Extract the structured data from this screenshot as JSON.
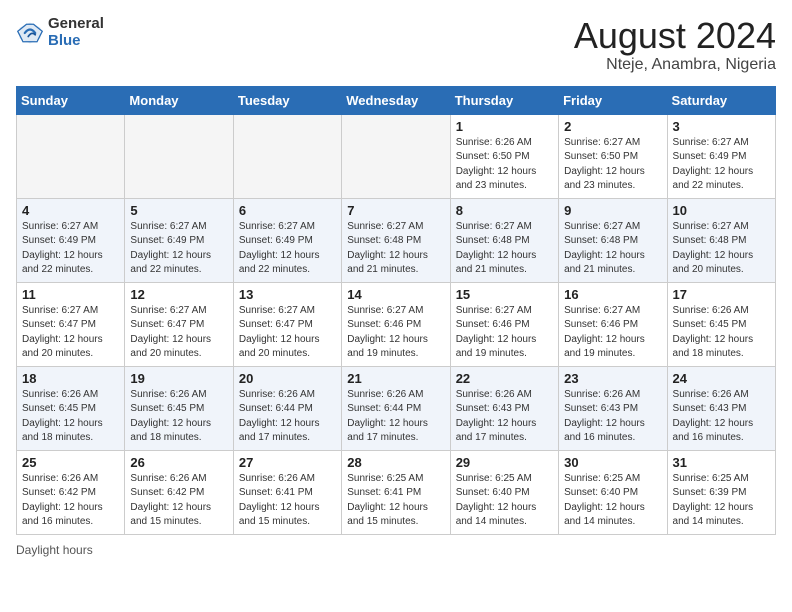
{
  "logo": {
    "general": "General",
    "blue": "Blue"
  },
  "header": {
    "title": "August 2024",
    "subtitle": "Nteje, Anambra, Nigeria"
  },
  "calendar": {
    "days_of_week": [
      "Sunday",
      "Monday",
      "Tuesday",
      "Wednesday",
      "Thursday",
      "Friday",
      "Saturday"
    ],
    "weeks": [
      {
        "cells": [
          {
            "day": "",
            "info": "",
            "empty": true
          },
          {
            "day": "",
            "info": "",
            "empty": true
          },
          {
            "day": "",
            "info": "",
            "empty": true
          },
          {
            "day": "",
            "info": "",
            "empty": true
          },
          {
            "day": "1",
            "info": "Sunrise: 6:26 AM\nSunset: 6:50 PM\nDaylight: 12 hours\nand 23 minutes.",
            "empty": false
          },
          {
            "day": "2",
            "info": "Sunrise: 6:27 AM\nSunset: 6:50 PM\nDaylight: 12 hours\nand 23 minutes.",
            "empty": false
          },
          {
            "day": "3",
            "info": "Sunrise: 6:27 AM\nSunset: 6:49 PM\nDaylight: 12 hours\nand 22 minutes.",
            "empty": false
          }
        ]
      },
      {
        "cells": [
          {
            "day": "4",
            "info": "Sunrise: 6:27 AM\nSunset: 6:49 PM\nDaylight: 12 hours\nand 22 minutes.",
            "empty": false
          },
          {
            "day": "5",
            "info": "Sunrise: 6:27 AM\nSunset: 6:49 PM\nDaylight: 12 hours\nand 22 minutes.",
            "empty": false
          },
          {
            "day": "6",
            "info": "Sunrise: 6:27 AM\nSunset: 6:49 PM\nDaylight: 12 hours\nand 22 minutes.",
            "empty": false
          },
          {
            "day": "7",
            "info": "Sunrise: 6:27 AM\nSunset: 6:48 PM\nDaylight: 12 hours\nand 21 minutes.",
            "empty": false
          },
          {
            "day": "8",
            "info": "Sunrise: 6:27 AM\nSunset: 6:48 PM\nDaylight: 12 hours\nand 21 minutes.",
            "empty": false
          },
          {
            "day": "9",
            "info": "Sunrise: 6:27 AM\nSunset: 6:48 PM\nDaylight: 12 hours\nand 21 minutes.",
            "empty": false
          },
          {
            "day": "10",
            "info": "Sunrise: 6:27 AM\nSunset: 6:48 PM\nDaylight: 12 hours\nand 20 minutes.",
            "empty": false
          }
        ]
      },
      {
        "cells": [
          {
            "day": "11",
            "info": "Sunrise: 6:27 AM\nSunset: 6:47 PM\nDaylight: 12 hours\nand 20 minutes.",
            "empty": false
          },
          {
            "day": "12",
            "info": "Sunrise: 6:27 AM\nSunset: 6:47 PM\nDaylight: 12 hours\nand 20 minutes.",
            "empty": false
          },
          {
            "day": "13",
            "info": "Sunrise: 6:27 AM\nSunset: 6:47 PM\nDaylight: 12 hours\nand 20 minutes.",
            "empty": false
          },
          {
            "day": "14",
            "info": "Sunrise: 6:27 AM\nSunset: 6:46 PM\nDaylight: 12 hours\nand 19 minutes.",
            "empty": false
          },
          {
            "day": "15",
            "info": "Sunrise: 6:27 AM\nSunset: 6:46 PM\nDaylight: 12 hours\nand 19 minutes.",
            "empty": false
          },
          {
            "day": "16",
            "info": "Sunrise: 6:27 AM\nSunset: 6:46 PM\nDaylight: 12 hours\nand 19 minutes.",
            "empty": false
          },
          {
            "day": "17",
            "info": "Sunrise: 6:26 AM\nSunset: 6:45 PM\nDaylight: 12 hours\nand 18 minutes.",
            "empty": false
          }
        ]
      },
      {
        "cells": [
          {
            "day": "18",
            "info": "Sunrise: 6:26 AM\nSunset: 6:45 PM\nDaylight: 12 hours\nand 18 minutes.",
            "empty": false
          },
          {
            "day": "19",
            "info": "Sunrise: 6:26 AM\nSunset: 6:45 PM\nDaylight: 12 hours\nand 18 minutes.",
            "empty": false
          },
          {
            "day": "20",
            "info": "Sunrise: 6:26 AM\nSunset: 6:44 PM\nDaylight: 12 hours\nand 17 minutes.",
            "empty": false
          },
          {
            "day": "21",
            "info": "Sunrise: 6:26 AM\nSunset: 6:44 PM\nDaylight: 12 hours\nand 17 minutes.",
            "empty": false
          },
          {
            "day": "22",
            "info": "Sunrise: 6:26 AM\nSunset: 6:43 PM\nDaylight: 12 hours\nand 17 minutes.",
            "empty": false
          },
          {
            "day": "23",
            "info": "Sunrise: 6:26 AM\nSunset: 6:43 PM\nDaylight: 12 hours\nand 16 minutes.",
            "empty": false
          },
          {
            "day": "24",
            "info": "Sunrise: 6:26 AM\nSunset: 6:43 PM\nDaylight: 12 hours\nand 16 minutes.",
            "empty": false
          }
        ]
      },
      {
        "cells": [
          {
            "day": "25",
            "info": "Sunrise: 6:26 AM\nSunset: 6:42 PM\nDaylight: 12 hours\nand 16 minutes.",
            "empty": false
          },
          {
            "day": "26",
            "info": "Sunrise: 6:26 AM\nSunset: 6:42 PM\nDaylight: 12 hours\nand 15 minutes.",
            "empty": false
          },
          {
            "day": "27",
            "info": "Sunrise: 6:26 AM\nSunset: 6:41 PM\nDaylight: 12 hours\nand 15 minutes.",
            "empty": false
          },
          {
            "day": "28",
            "info": "Sunrise: 6:25 AM\nSunset: 6:41 PM\nDaylight: 12 hours\nand 15 minutes.",
            "empty": false
          },
          {
            "day": "29",
            "info": "Sunrise: 6:25 AM\nSunset: 6:40 PM\nDaylight: 12 hours\nand 14 minutes.",
            "empty": false
          },
          {
            "day": "30",
            "info": "Sunrise: 6:25 AM\nSunset: 6:40 PM\nDaylight: 12 hours\nand 14 minutes.",
            "empty": false
          },
          {
            "day": "31",
            "info": "Sunrise: 6:25 AM\nSunset: 6:39 PM\nDaylight: 12 hours\nand 14 minutes.",
            "empty": false
          }
        ]
      }
    ]
  },
  "footer": {
    "note": "Daylight hours"
  }
}
